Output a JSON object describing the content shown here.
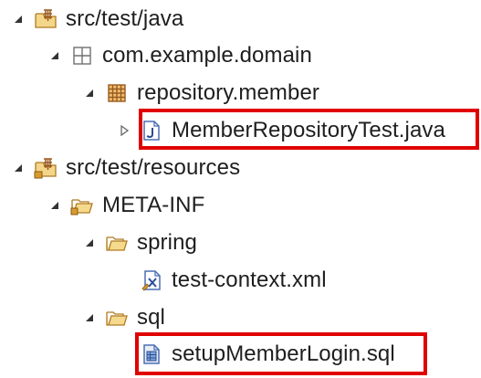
{
  "tree": {
    "items": [
      {
        "label": "src/test/java",
        "icon": "source-folder-icon",
        "expanded": true
      },
      {
        "label": "com.example.domain",
        "icon": "package-icon",
        "expanded": true
      },
      {
        "label": "repository.member",
        "icon": "package-icon",
        "expanded": true
      },
      {
        "label": "MemberRepositoryTest.java",
        "icon": "java-file-icon",
        "expanded": false,
        "highlighted": true
      },
      {
        "label": "src/test/resources",
        "icon": "source-folder-icon",
        "expanded": true
      },
      {
        "label": "META-INF",
        "icon": "folder-icon",
        "expanded": true
      },
      {
        "label": "spring",
        "icon": "folder-icon",
        "expanded": true
      },
      {
        "label": "test-context.xml",
        "icon": "xml-file-icon",
        "expanded": false
      },
      {
        "label": "sql",
        "icon": "folder-icon",
        "expanded": true
      },
      {
        "label": "setupMemberLogin.sql",
        "icon": "sql-file-icon",
        "expanded": false,
        "highlighted": true
      }
    ]
  },
  "colors": {
    "highlight": "#e00000",
    "folder": "#e6b85c",
    "package": "#b9783c",
    "toggle": "#333333"
  }
}
